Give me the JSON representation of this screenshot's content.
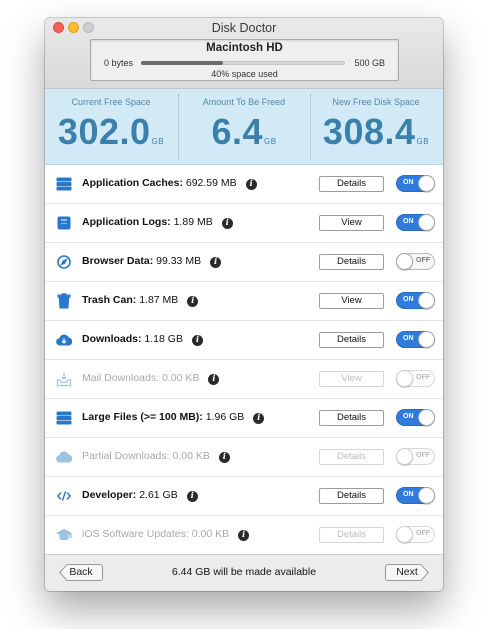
{
  "window": {
    "title": "Disk Doctor"
  },
  "disk": {
    "name": "Macintosh HD",
    "min_label": "0 bytes",
    "max_label": "500 GB",
    "usage_text": "40% space used",
    "used_fraction": 0.4
  },
  "stats": [
    {
      "label": "Current Free Space",
      "value": "302.0",
      "unit": "GB"
    },
    {
      "label": "Amount To Be Freed",
      "value": "6.4",
      "unit": "GB"
    },
    {
      "label": "New Free Disk Space",
      "value": "308.4",
      "unit": "GB"
    }
  ],
  "rows": [
    {
      "name": "Application Caches:",
      "size": "692.59 MB",
      "icon": "stack-icon",
      "button": "Details",
      "toggle": "ON",
      "enabled": true
    },
    {
      "name": "Application Logs:",
      "size": "1.89 MB",
      "icon": "log-box-icon",
      "button": "View",
      "toggle": "ON",
      "enabled": true
    },
    {
      "name": "Browser Data:",
      "size": "99.33 MB",
      "icon": "compass-icon",
      "button": "Details",
      "toggle": "OFF",
      "enabled": true
    },
    {
      "name": "Trash Can:",
      "size": "1.87 MB",
      "icon": "trash-icon",
      "button": "View",
      "toggle": "ON",
      "enabled": true
    },
    {
      "name": "Downloads:",
      "size": "1.18 GB",
      "icon": "cloud-download-icon",
      "button": "Details",
      "toggle": "ON",
      "enabled": true
    },
    {
      "name": "Mail Downloads:",
      "size": "0.00 KB",
      "icon": "mail-tray-icon",
      "button": "View",
      "toggle": "OFF",
      "enabled": false
    },
    {
      "name": "Large Files (>= 100 MB):",
      "size": "1.96 GB",
      "icon": "stack-icon",
      "button": "Details",
      "toggle": "ON",
      "enabled": true
    },
    {
      "name": "Partial Downloads:",
      "size": "0.00 KB",
      "icon": "cloud-icon",
      "button": "Details",
      "toggle": "OFF",
      "enabled": false
    },
    {
      "name": "Developer:",
      "size": "2.61 GB",
      "icon": "code-icon",
      "button": "Details",
      "toggle": "ON",
      "enabled": true
    },
    {
      "name": "iOS Software Updates:",
      "size": "0.00 KB",
      "icon": "graduation-cap-icon",
      "button": "Details",
      "toggle": "OFF",
      "enabled": false
    }
  ],
  "footer": {
    "back_label": "Back",
    "status": "6.44 GB will be made available",
    "next_label": "Next"
  },
  "colors": {
    "accent": "#2f7cde",
    "stat_value": "#3b80aa",
    "stat_panel": "#d2eaf6",
    "icon": "#2a78c8",
    "icon_disabled": "#9cc3e2"
  }
}
